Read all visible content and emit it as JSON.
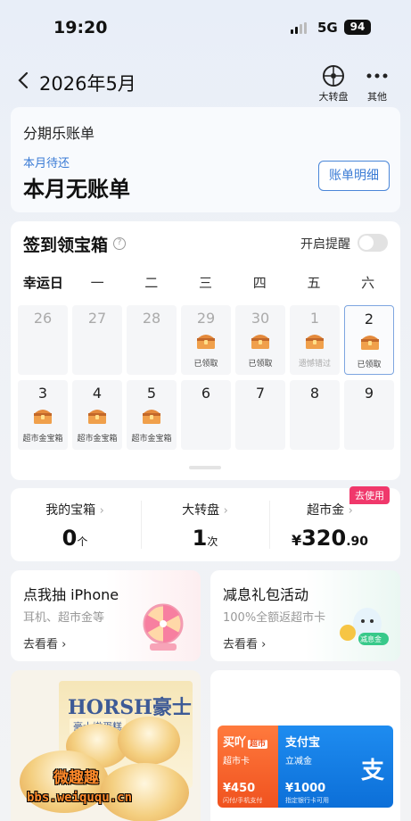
{
  "status": {
    "time": "19:20",
    "network": "5G",
    "battery": "94"
  },
  "nav": {
    "title": "2026年5月",
    "wheel_label": "大转盘",
    "more_label": "其他"
  },
  "bill": {
    "title": "分期乐账单",
    "subtitle": "本月待还",
    "main": "本月无账单",
    "detail_button": "账单明细"
  },
  "checkin": {
    "title": "签到领宝箱",
    "help": "?",
    "remind_label": "开启提醒",
    "weekdays": [
      "幸运日",
      "一",
      "二",
      "三",
      "四",
      "五",
      "六"
    ],
    "days": [
      {
        "num": "26",
        "note": "",
        "chest": false
      },
      {
        "num": "27",
        "note": "",
        "chest": false
      },
      {
        "num": "28",
        "note": "",
        "chest": false
      },
      {
        "num": "29",
        "note": "已领取",
        "chest": true
      },
      {
        "num": "30",
        "note": "已领取",
        "chest": true
      },
      {
        "num": "1",
        "note": "遗憾错过",
        "chest": true
      },
      {
        "num": "2",
        "note": "已领取",
        "chest": true
      },
      {
        "num": "3",
        "note": "超市金宝箱",
        "chest": true
      },
      {
        "num": "4",
        "note": "超市金宝箱",
        "chest": true
      },
      {
        "num": "5",
        "note": "超市金宝箱",
        "chest": true
      },
      {
        "num": "6",
        "note": "",
        "chest": false
      },
      {
        "num": "7",
        "note": "",
        "chest": false
      },
      {
        "num": "8",
        "note": "",
        "chest": false
      },
      {
        "num": "9",
        "note": "",
        "chest": false
      }
    ]
  },
  "stats": {
    "chest": {
      "label": "我的宝箱",
      "value": "0",
      "unit": "个"
    },
    "wheel": {
      "label": "大转盘",
      "value": "1",
      "unit": "次"
    },
    "gold": {
      "label": "超市金",
      "currency": "¥",
      "value": "320",
      "decimal": ".90",
      "badge": "去使用"
    }
  },
  "promos": {
    "left": {
      "title": "点我抽 iPhone",
      "subtitle": "耳机、超市金等",
      "link": "去看看"
    },
    "right": {
      "title": "减息礼包活动",
      "subtitle": "100%全额返超市卡",
      "link": "去看看",
      "badge": "减息金"
    }
  },
  "ad_left": {
    "brand": "HORSH豪士",
    "sub": "豪士嫩蛋糕",
    "watermark_top": "微趣趣",
    "watermark_url": "bbs.weiququ.cn"
  },
  "ad_right": {
    "card1": {
      "title": "买吖",
      "tag": "超市",
      "sub": "超市卡",
      "amount": "¥450",
      "small": "闪付/手机支付"
    },
    "card2": {
      "title": "支付宝",
      "sub": "立减金",
      "amount": "¥1000",
      "small": "指定银行卡可用"
    },
    "logo": "支"
  },
  "colors": {
    "accent": "#3a7bd5",
    "badge": "#f0386b",
    "orange": "#f0521f",
    "blue": "#0c6fd8"
  }
}
